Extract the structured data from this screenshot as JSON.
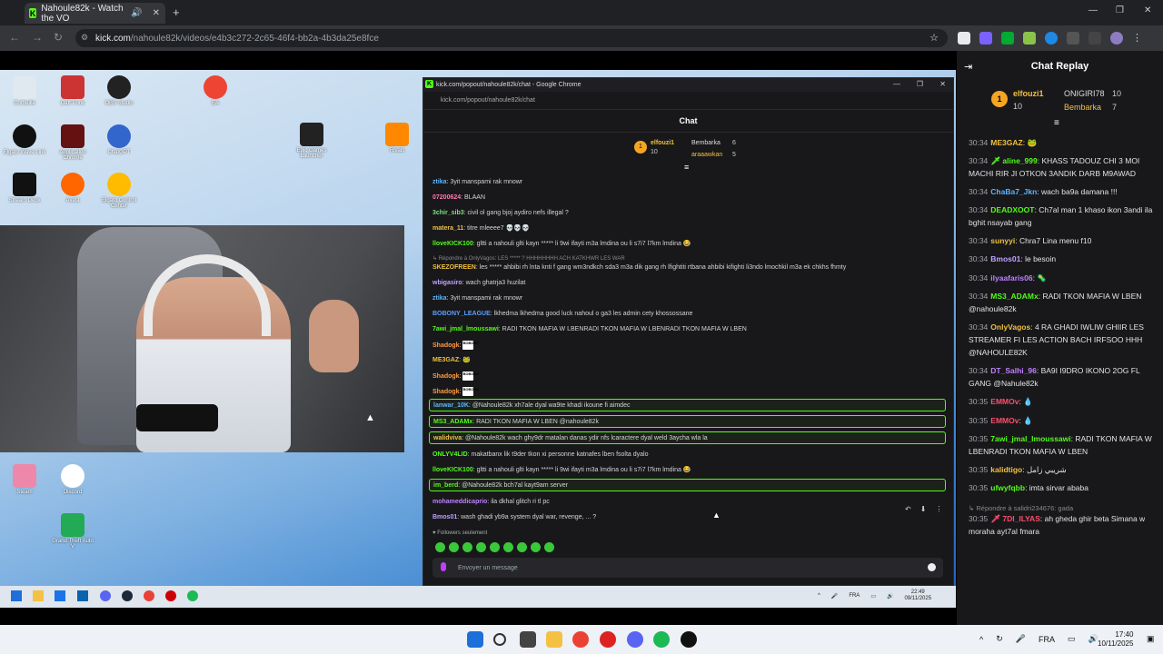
{
  "browser": {
    "tab_title": "Nahoule82k - Watch the VO",
    "url_host": "kick.com",
    "url_path": "/nahoule82k/videos/e4b3c272-2c65-46f4-bb2a-4b3da25e8fce"
  },
  "desktop_icons": [
    "Corbeille",
    "Daft Punk",
    "OBS Studio",
    "EA",
    "Elgato Wave Link",
    "Application Chrome",
    "ChatGPT",
    "Epic Games Launcher",
    "Stream Deck",
    "Avast",
    "Elgato Control Center",
    "Rivals",
    "Steam",
    "Discord",
    "Grand Theft Auto V"
  ],
  "popout": {
    "title": "kick.com/popout/nahoule82k/chat - Google Chrome",
    "url": "kick.com/popout/nahoule82k/chat",
    "header": "Chat",
    "leaders": [
      {
        "name": "elfouzi1",
        "count": "10"
      },
      {
        "name": "Bembarka",
        "count": "6"
      },
      {
        "name": "araaawkan",
        "count": "5"
      }
    ],
    "messages": [
      {
        "user": "ztika",
        "color": "#5ab5ff",
        "text": "3yit manspami rak mnowr"
      },
      {
        "user": "07200624",
        "color": "#ff7ab0",
        "text": "BLAAN"
      },
      {
        "user": "3chir_sib3",
        "color": "#7fe07f",
        "text": "civil ol gang bjoj aydiro nefs illegal ?"
      },
      {
        "user": "matera_11",
        "color": "#f0c040",
        "text": "titre mleeee7 💀💀💀"
      },
      {
        "user": "lloveKICK100",
        "color": "#53fc18",
        "text": "gltti a nahouli glti kayn ***** li 9wi ifayti m3a lmdina ou li s7i7 l7km lmdina 😂"
      },
      {
        "user": "↳ Répondre à OnlyVagos: LES ***** ? HHHHHHHH ACH KATKHWR LES WAR",
        "color": "#888",
        "text": ""
      },
      {
        "user": "SKEZOFREEN",
        "color": "#f0c040",
        "text": "les ***** ahbibi rh lnta knti f gang wm3ndkch sda3 m3a dik gang rh lfightiti rtbana ahbibi kifighti li3ndo lmochkil m3a ek chkhs fhmty"
      },
      {
        "user": "wbigasiro",
        "color": "#c0a0ff",
        "text": "wach ghatrja3 huzilat"
      },
      {
        "user": "ztika",
        "color": "#5ab5ff",
        "text": "3yit manspami rak mnowr"
      },
      {
        "user": "BOBONY_LEAGUE",
        "color": "#5a9fff",
        "text": "lkhedma lkhedma good luck nahoul o ga3 les admin cety khossossane"
      },
      {
        "user": "7awi_jmal_lmoussawi",
        "color": "#53fc18",
        "text": "RADI TKON MAFIA W LBENRADI TKON MAFIA W LBENRADI TKON MAFIA W LBEN"
      },
      {
        "user": "Shadogk",
        "color": "#ff9a3c",
        "text": "BOBONY"
      },
      {
        "user": "ME3GAZ",
        "color": "#f0c040",
        "text": "🐸"
      },
      {
        "user": "Shadogk",
        "color": "#ff9a3c",
        "text": "BOBONY"
      },
      {
        "user": "Shadogk",
        "color": "#ff9a3c",
        "text": "BOBONY"
      },
      {
        "user": "lanwar_10K",
        "color": "#5ab5ff",
        "text": "@Nahoule82k xh7ale dyal wa9te khadi ikoune fi aimdec"
      },
      {
        "user": "MS3_ADAMx",
        "color": "#53fc18",
        "text": "RADI TKON MAFIA W LBEN @nahoule82k"
      },
      {
        "user": "walidviva",
        "color": "#f0c040",
        "text": "@Nahoule82k wach ghy9dr matalan danas ydir nfs lcaractere dyal weld 3aycha wla la"
      },
      {
        "user": "ONLYV4LID",
        "color": "#53fc18",
        "text": "makatbanx lik t9der tkon xi personne katnafes lben fsolta dyalo"
      },
      {
        "user": "lloveKICK100",
        "color": "#53fc18",
        "text": "gltti a nahouli glti kayn ***** li 9wi ifayti m3a lmdina ou li s7i7 l7km lmdina 😂"
      },
      {
        "user": "im_berd",
        "color": "#53fc18",
        "text": "@Nahoule82k bch7al kayt9am server"
      },
      {
        "user": "mohameddicaprio",
        "color": "#c080ff",
        "text": "ila dkhal glitch ri tl pc"
      },
      {
        "user": "Bmos01",
        "color": "#c0a0ff",
        "text": "wash ghadi yb9a system dyal war, revenge, ... ?"
      }
    ],
    "followers_only": "Followers seulement",
    "input_placeholder": "Envoyer un message",
    "clock_time": "22:49",
    "clock_date": "09/11/2025",
    "lang": "FRA"
  },
  "replay": {
    "title": "Chat Replay",
    "leaders": [
      {
        "name": "elfouzi1",
        "count": "10"
      },
      {
        "name": "ONIGIRI78",
        "count": "10"
      },
      {
        "name": "Bembarka",
        "count": "7"
      }
    ],
    "messages": [
      {
        "time": "30:34",
        "user": "ME3GAZ",
        "color": "#f0c040",
        "text": "🐸"
      },
      {
        "time": "30:34",
        "user": "🗡 aline_999",
        "color": "#53fc18",
        "text": "KHASS TADOUZ CHI 3 MOI MACHI RIR JI OTKON 3ANDIK DARB M9AWAD"
      },
      {
        "time": "30:34",
        "user": "ChaBa7_Jkn",
        "color": "#5ab5ff",
        "text": "wach ba9a damana !!!"
      },
      {
        "time": "30:34",
        "user": "DEADXOOT",
        "color": "#53fc18",
        "text": "Ch7al man 1 khaso ikon 3andi ila bghit nsayab gang"
      },
      {
        "time": "30:34",
        "user": "sunyyi",
        "color": "#f0c040",
        "text": "Chra7 Lina menu f10"
      },
      {
        "time": "30:34",
        "user": "Bmos01",
        "color": "#c0a0ff",
        "text": "le besoin"
      },
      {
        "time": "30:34",
        "user": "ilyaafaris06",
        "color": "#c080ff",
        "text": "🦠"
      },
      {
        "time": "30:34",
        "user": "MS3_ADAMx",
        "color": "#53fc18",
        "text": "RADI TKON MAFIA W LBEN @nahoule82k"
      },
      {
        "time": "30:34",
        "user": "OnlyVagos",
        "color": "#f0c040",
        "text": "4 RA GHADI IWLIW GHIIR LES STREAMER FI LES ACTION BACH IRFSOO HHH @NAHOULE82K"
      },
      {
        "time": "30:34",
        "user": "DT_Salhi_96",
        "color": "#c080ff",
        "text": "BA9I I9DRO IKONO 2OG FL GANG @Nahule82k"
      },
      {
        "time": "30:35",
        "user": "EMMOv",
        "color": "#ff4d6d",
        "text": "💧"
      },
      {
        "time": "30:35",
        "user": "EMMOv",
        "color": "#ff4d6d",
        "text": "💧"
      },
      {
        "time": "30:35",
        "user": "7awi_jmal_lmoussawi",
        "color": "#53fc18",
        "text": "RADI TKON MAFIA W LBENRADI TKON MAFIA W LBEN"
      },
      {
        "time": "30:35",
        "user": "kalidtigo",
        "color": "#f0c040",
        "text": "شريبي زامل"
      },
      {
        "time": "30:35",
        "user": "ufwyfqbb",
        "color": "#53fc18",
        "text": "imta sirvar ababa"
      },
      {
        "time": "",
        "user": "↳ Répondre à salidri234676: gada",
        "color": "#888",
        "text": ""
      },
      {
        "time": "30:35",
        "user": "🗡 7DI_ILYAS",
        "color": "#ff4d6d",
        "text": "ah gheda ghir beta Simana w moraha ayt7al fmara"
      }
    ]
  },
  "os_taskbar": {
    "lang": "FRA",
    "time": "17:40",
    "date": "10/11/2025"
  }
}
